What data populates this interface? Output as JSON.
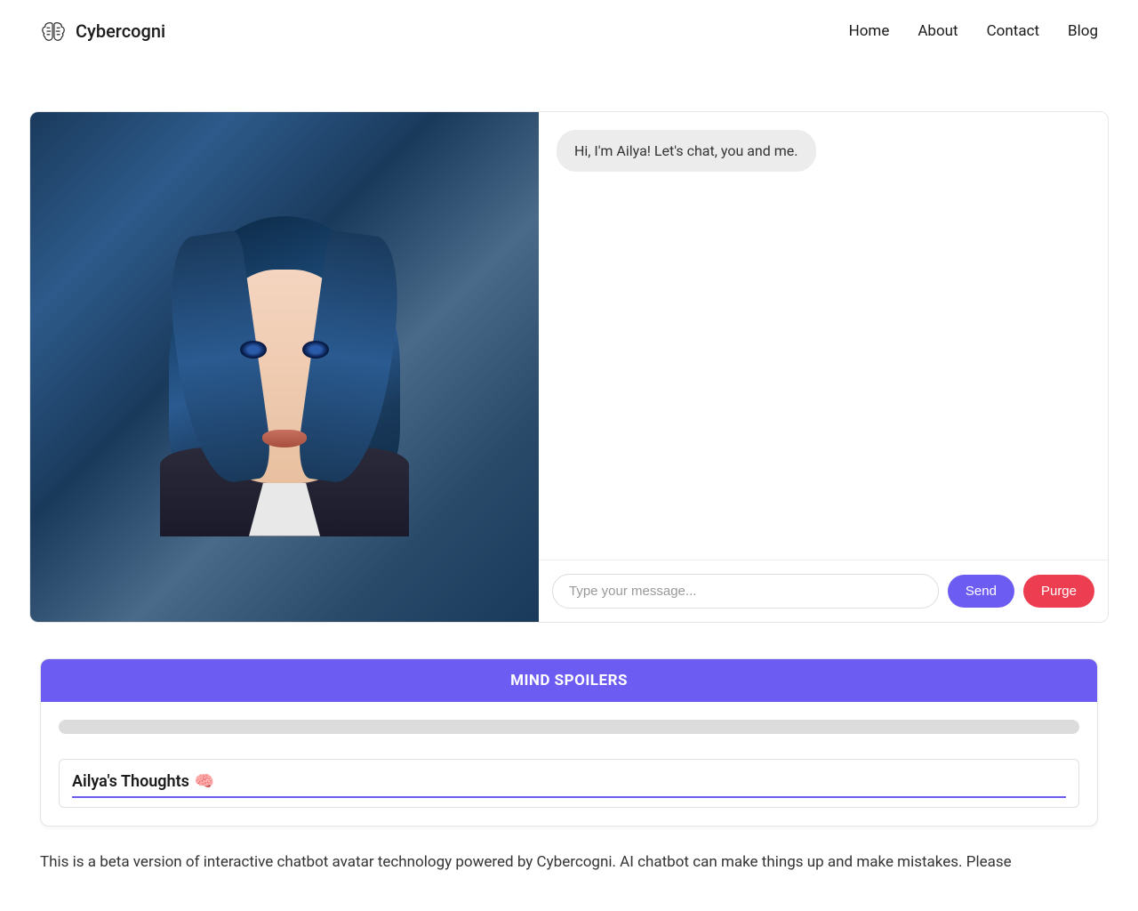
{
  "brand": "Cybercogni",
  "nav": {
    "home": "Home",
    "about": "About",
    "contact": "Contact",
    "blog": "Blog"
  },
  "chat": {
    "greeting": "Hi, I'm Ailya! Let's chat, you and me.",
    "input_placeholder": "Type your message...",
    "send_label": "Send",
    "purge_label": "Purge"
  },
  "spoilers": {
    "header": "MIND SPOILERS",
    "thoughts_title": "Ailya's Thoughts",
    "brain_emoji": "🧠"
  },
  "disclaimer": "This is a beta version of interactive chatbot avatar technology powered by Cybercogni. AI chatbot can make things up and make mistakes. Please"
}
